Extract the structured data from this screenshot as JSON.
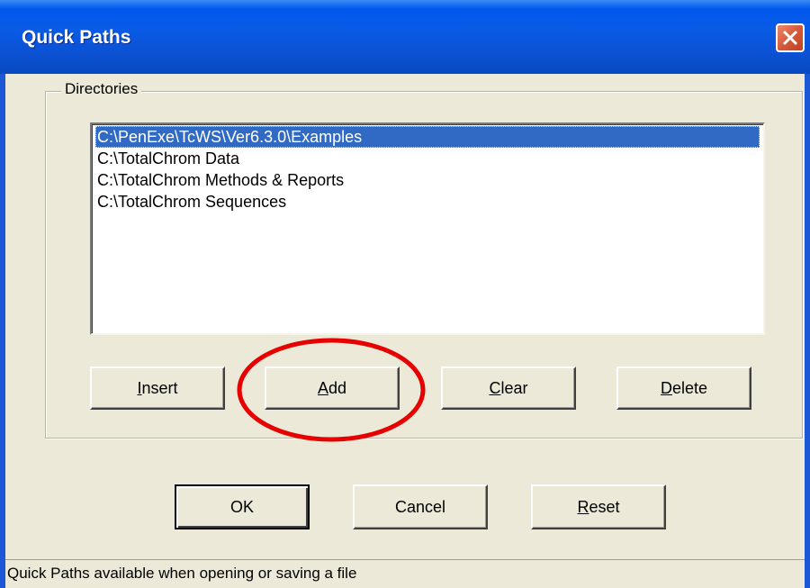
{
  "window": {
    "title": "Quick Paths",
    "close_icon": "close-icon"
  },
  "directories": {
    "legend": "Directories",
    "items": [
      "C:\\PenExe\\TcWS\\Ver6.3.0\\Examples",
      "C:\\TotalChrom Data",
      "C:\\TotalChrom Methods & Reports",
      "C:\\TotalChrom Sequences"
    ],
    "selected_index": 0
  },
  "list_buttons": {
    "insert": {
      "pre": "",
      "accel": "I",
      "post": "nsert"
    },
    "add": {
      "pre": "",
      "accel": "A",
      "post": "dd"
    },
    "clear": {
      "pre": "",
      "accel": "C",
      "post": "lear"
    },
    "delete": {
      "pre": "",
      "accel": "D",
      "post": "elete"
    }
  },
  "dialog_buttons": {
    "ok": "OK",
    "cancel": "Cancel",
    "reset": {
      "accel": "R",
      "post": "eset"
    }
  },
  "status": {
    "text": "Quick Paths available when opening or saving a file"
  },
  "colors": {
    "titlebar": "#0A5BE6",
    "selection": "#316AC5",
    "annotation": "#E60000",
    "face": "#ECE9D8"
  }
}
